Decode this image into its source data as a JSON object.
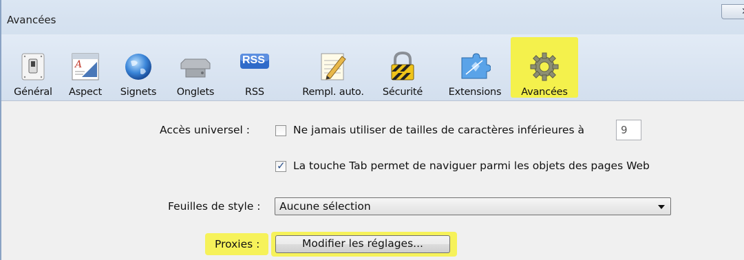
{
  "window": {
    "title": "Avancées",
    "close_glyph": "✕"
  },
  "toolbar": {
    "items": [
      {
        "label": "Général",
        "icon": "general-switch-icon"
      },
      {
        "label": "Aspect",
        "icon": "aspect-font-icon"
      },
      {
        "label": "Signets",
        "icon": "signets-globe-icon"
      },
      {
        "label": "Onglets",
        "icon": "onglets-tab-icon"
      },
      {
        "label": "RSS",
        "icon": "rss-icon"
      },
      {
        "label": "Rempl. auto.",
        "icon": "autofill-pencil-icon"
      },
      {
        "label": "Sécurité",
        "icon": "security-lock-icon"
      },
      {
        "label": "Extensions",
        "icon": "extensions-puzzle-icon"
      },
      {
        "label": "Avancées",
        "icon": "advanced-gear-icon"
      }
    ],
    "rss_text": "RSS",
    "selected": "Avancées",
    "highlight_color": "#f4f14c"
  },
  "accessibility": {
    "label": "Accès universel :",
    "min_font_checkbox_label": "Ne jamais utiliser de tailles de caractères inférieures à",
    "min_font_checked": false,
    "min_font_value": "9",
    "tab_checkbox_label": "La touche Tab permet de naviguer parmi les objets des pages Web",
    "tab_checked": true
  },
  "stylesheet": {
    "label": "Feuilles de style :",
    "selected": "Aucune sélection"
  },
  "proxies": {
    "label": "Proxies :",
    "button_label": "Modifier les réglages..."
  }
}
